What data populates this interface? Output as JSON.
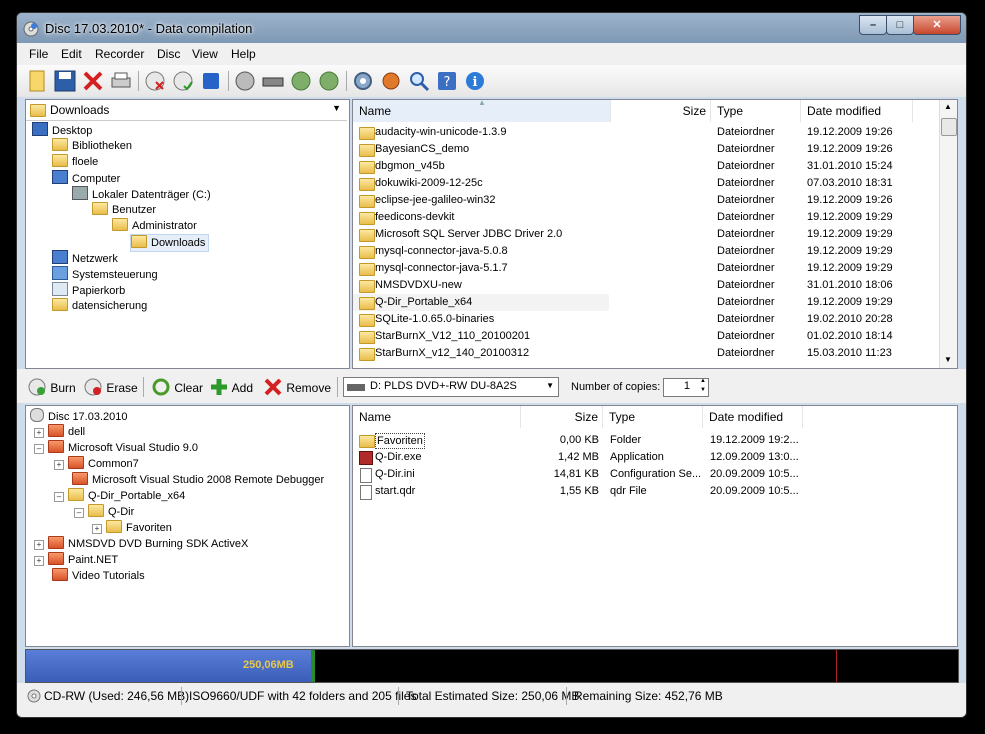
{
  "window": {
    "title": "Disc 17.03.2010* - Data compilation"
  },
  "menu": [
    "File",
    "Edit",
    "Recorder",
    "Disc",
    "View",
    "Help"
  ],
  "top_tree": {
    "combo_value": "Downloads",
    "items": [
      {
        "label": "Desktop"
      },
      {
        "label": "Bibliotheken"
      },
      {
        "label": "floele"
      },
      {
        "label": "Computer"
      },
      {
        "label": "Lokaler Datenträger (C:)"
      },
      {
        "label": "Benutzer"
      },
      {
        "label": "Administrator"
      },
      {
        "label": "Downloads"
      },
      {
        "label": "Netzwerk"
      },
      {
        "label": "Systemsteuerung"
      },
      {
        "label": "Papierkorb"
      },
      {
        "label": "datensicherung"
      }
    ]
  },
  "top_list": {
    "columns": [
      "Name",
      "Size",
      "Type",
      "Date modified"
    ],
    "rows": [
      {
        "name": "audacity-win-unicode-1.3.9",
        "type": "Dateiordner",
        "date": "19.12.2009 19:26"
      },
      {
        "name": "BayesianCS_demo",
        "type": "Dateiordner",
        "date": "19.12.2009 19:26"
      },
      {
        "name": "dbgmon_v45b",
        "type": "Dateiordner",
        "date": "31.01.2010 15:24"
      },
      {
        "name": "dokuwiki-2009-12-25c",
        "type": "Dateiordner",
        "date": "07.03.2010 18:31"
      },
      {
        "name": "eclipse-jee-galileo-win32",
        "type": "Dateiordner",
        "date": "19.12.2009 19:26"
      },
      {
        "name": "feedicons-devkit",
        "type": "Dateiordner",
        "date": "19.12.2009 19:29"
      },
      {
        "name": "Microsoft SQL Server JDBC Driver 2.0",
        "type": "Dateiordner",
        "date": "19.12.2009 19:29"
      },
      {
        "name": "mysql-connector-java-5.0.8",
        "type": "Dateiordner",
        "date": "19.12.2009 19:29"
      },
      {
        "name": "mysql-connector-java-5.1.7",
        "type": "Dateiordner",
        "date": "19.12.2009 19:29"
      },
      {
        "name": "NMSDVDXU-new",
        "type": "Dateiordner",
        "date": "31.01.2010 18:06"
      },
      {
        "name": "Q-Dir_Portable_x64",
        "type": "Dateiordner",
        "date": "19.12.2009 19:29"
      },
      {
        "name": "SQLite-1.0.65.0-binaries",
        "type": "Dateiordner",
        "date": "19.02.2010 20:28"
      },
      {
        "name": "StarBurnX_V12_110_20100201",
        "type": "Dateiordner",
        "date": "01.02.2010 18:14"
      },
      {
        "name": "StarBurnX_v12_140_20100312",
        "type": "Dateiordner",
        "date": "15.03.2010 11:23"
      }
    ]
  },
  "cd_toolbar": {
    "burn": "Burn",
    "erase": "Erase",
    "clear": "Clear",
    "add": "Add",
    "remove": "Remove",
    "drive": "D: PLDS DVD+-RW DU-8A2S",
    "copies_label": "Number of copies:",
    "copies_value": "1"
  },
  "disc_tree": {
    "items": [
      {
        "label": "Disc 17.03.2010"
      },
      {
        "label": "dell"
      },
      {
        "label": "Microsoft Visual Studio 9.0"
      },
      {
        "label": "Common7"
      },
      {
        "label": "Microsoft Visual Studio 2008 Remote Debugger"
      },
      {
        "label": "Q-Dir_Portable_x64"
      },
      {
        "label": "Q-Dir"
      },
      {
        "label": "Favoriten"
      },
      {
        "label": "NMSDVD DVD Burning SDK ActiveX"
      },
      {
        "label": "Paint.NET"
      },
      {
        "label": "Video Tutorials"
      }
    ]
  },
  "disc_list": {
    "columns": [
      "Name",
      "Size",
      "Type",
      "Date modified"
    ],
    "rows": [
      {
        "name": "Favoriten",
        "size": "0,00 KB",
        "type": "Folder",
        "date": "19.12.2009 19:2..."
      },
      {
        "name": "Q-Dir.exe",
        "size": "1,42 MB",
        "type": "Application",
        "date": "12.09.2009 13:0..."
      },
      {
        "name": "Q-Dir.ini",
        "size": "14,81 KB",
        "type": "Configuration Se...",
        "date": "20.09.2009 10:5..."
      },
      {
        "name": "start.qdr",
        "size": "1,55 KB",
        "type": "qdr File",
        "date": "20.09.2009 10:5..."
      }
    ]
  },
  "progress": {
    "label": "250,06MB",
    "fraction": 0.306
  },
  "status": {
    "media": "CD-RW (Used: 246,56 MB)",
    "fs": "ISO9660/UDF with 42 folders and 205 files",
    "total": "Total Estimated Size: 250,06 MB",
    "remaining": "Remaining Size: 452,76 MB"
  },
  "colors": {
    "progress_fill": "#3b5fb8",
    "progress_text": "#e6c84a",
    "selection": "#d9e8fb"
  }
}
